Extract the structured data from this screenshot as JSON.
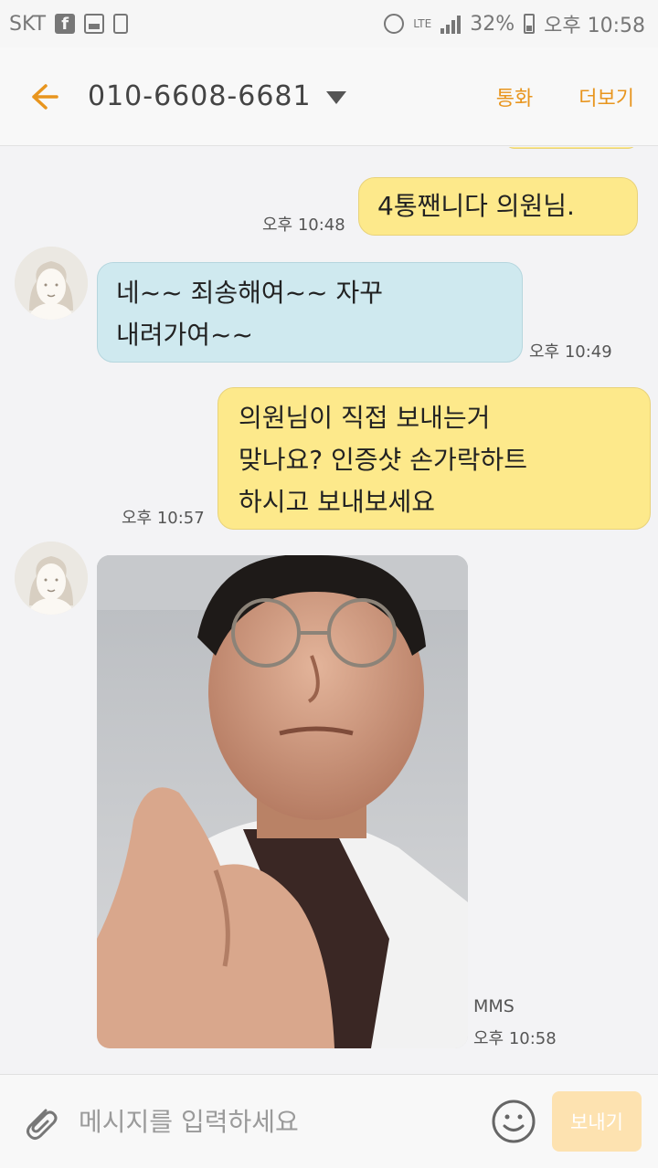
{
  "status_bar": {
    "carrier": "SKT",
    "network": "LTE",
    "battery": "32%",
    "time": "오후 10:58"
  },
  "header": {
    "contact": "010-6608-6681",
    "call_label": "통화",
    "more_label": "더보기"
  },
  "messages": [
    {
      "from": "me",
      "text": "4통짼니다 의원님.",
      "time": "오후 10:48"
    },
    {
      "from": "them",
      "lines": [
        "네~~ 죄송해여~~ 자꾸",
        "내려가여~~"
      ],
      "time": "오후 10:49"
    },
    {
      "from": "me",
      "lines": [
        "의원님이 직접 보내는거",
        "맞나요? 인증샷 손가락하트",
        "하시고 보내보세요"
      ],
      "time": "오후 10:57"
    },
    {
      "from": "them",
      "type": "image",
      "label": "MMS",
      "time": "오후 10:58"
    }
  ],
  "input": {
    "placeholder": "메시지를 입력하세요",
    "send_label": "보내기"
  },
  "colors": {
    "accent": "#e8951e",
    "my_bubble": "#fde98b",
    "their_bubble": "#cfe9ef"
  }
}
